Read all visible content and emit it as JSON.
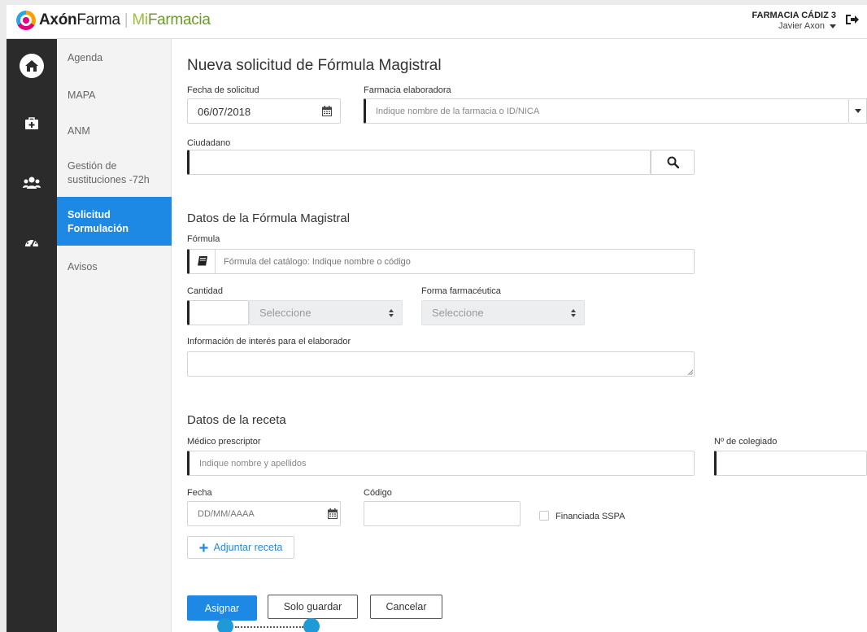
{
  "header": {
    "logo_axon": "Axón",
    "logo_farma": "Farma",
    "logo_sep": "|",
    "logo_mi": "Mi",
    "logo_farmacia": "Farmacia",
    "pharmacy_name": "FARMACIA CÁDIZ 3",
    "user_name": "Javier Axon"
  },
  "rail": {
    "icons": [
      "home-icon",
      "medkit-icon",
      "users-icon",
      "dashboard-icon"
    ]
  },
  "menu": {
    "items": [
      {
        "label": "Agenda"
      },
      {
        "label": "MAPA"
      },
      {
        "label": "ANM"
      },
      {
        "label": "Gestión de sustituciones -72h"
      },
      {
        "label": "Solicitud Formulación",
        "active": true
      },
      {
        "label": "Avisos"
      }
    ]
  },
  "form": {
    "title": "Nueva solicitud de Fórmula Magistral",
    "fecha_solicitud_label": "Fecha de solicitud",
    "fecha_solicitud_value": "06/07/2018",
    "farmacia_label": "Farmacia elaboradora",
    "farmacia_placeholder": "Indique nombre de la farmacia o ID/NICA",
    "ciudadano_label": "Ciudadano",
    "ciudadano_value": "",
    "datos_formula_title": "Datos de la Fórmula Magistral",
    "formula_label": "Fórmula",
    "formula_placeholder": "Fórmula del catálogo: Indique nombre o código",
    "cantidad_label": "Cantidad",
    "cantidad_select": "Seleccione",
    "forma_label": "Forma farmacéutica",
    "forma_select": "Seleccione",
    "info_label": "Información de interés para el elaborador",
    "datos_receta_title": "Datos de la receta",
    "medico_label": "Médico prescriptor",
    "medico_placeholder": "Indique nombre y apellidos",
    "colegiado_label": "Nº de colegiado",
    "fecha_label": "Fecha",
    "fecha_placeholder": "DD/MM/AAAA",
    "codigo_label": "Código",
    "financiada_label": "Financiada SSPA",
    "adjuntar_label": "Adjuntar receta",
    "asignar_label": "Asignar",
    "guardar_label": "Solo guardar",
    "cancelar_label": "Cancelar"
  },
  "colors": {
    "accent": "#1e88e5",
    "rail": "#2b2b2b",
    "menu_bg": "#f3f3f3"
  }
}
